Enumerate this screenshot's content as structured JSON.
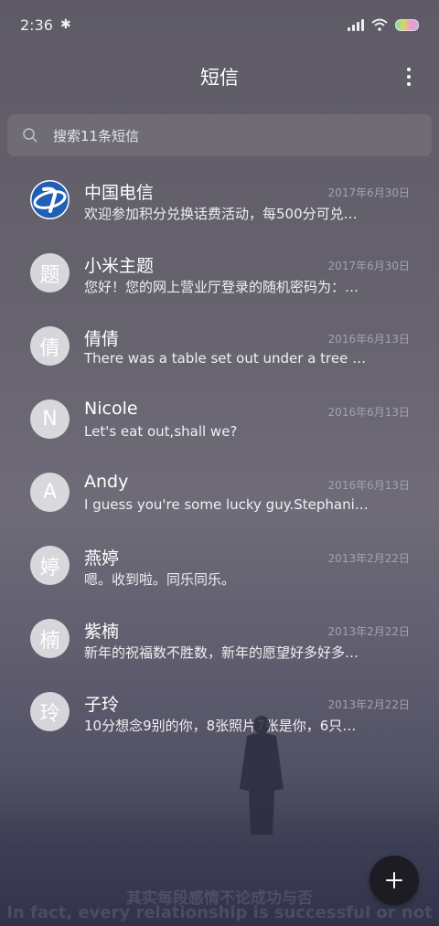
{
  "status_bar": {
    "time": "2:36"
  },
  "app_bar": {
    "title": "短信"
  },
  "search": {
    "placeholder": "搜索11条短信"
  },
  "conversations": [
    {
      "avatar": "",
      "name": "中国电信",
      "date": "2017年6月30日",
      "preview": "欢迎参加积分兑换话费活动，每500分可兑换…"
    },
    {
      "avatar": "题",
      "name": "小米主题",
      "date": "2017年6月30日",
      "preview": "您好！您的网上营业厅登录的随机密码为：…"
    },
    {
      "avatar": "倩",
      "name": "倩倩",
      "date": "2016年6月13日",
      "preview": "There was a table set out under a tree in front of the house"
    },
    {
      "avatar": "N",
      "name": "Nicole",
      "date": "2016年6月13日",
      "preview": "Let's eat out,shall we?"
    },
    {
      "avatar": "A",
      "name": "Andy",
      "date": "2016年6月13日",
      "preview": "I guess you're some lucky guy.Stephanie…"
    },
    {
      "avatar": "婷",
      "name": "燕婷",
      "date": "2013年2月22日",
      "preview": "嗯。收到啦。同乐同乐。"
    },
    {
      "avatar": "楠",
      "name": "紫楠",
      "date": "2013年2月22日",
      "preview": "新年的祝福数不胜数，新年的愿望好多好多…"
    },
    {
      "avatar": "玲",
      "name": "子玲",
      "date": "2013年2月22日",
      "preview": "10分想念9别的你，8张照片7张是你，6只…"
    }
  ],
  "wallpaper": {
    "caption_cn": "其实每段感情不论成功与否",
    "caption_en": "In fact, every relationship is successful or not"
  },
  "colors": {
    "accent_fab": "#1c1c22",
    "telecom_blue": "#1f5fb5"
  }
}
